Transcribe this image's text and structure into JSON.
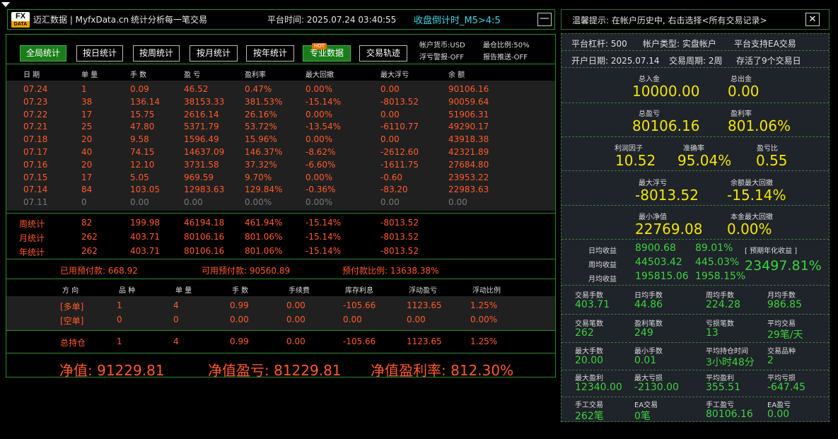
{
  "titlebar": {
    "logo_top": "FX",
    "logo_bottom": "DATA",
    "brand": "迈汇数据 | MyfxData.cn",
    "slogan": "统计分析每一笔交易",
    "platform_time": "平台时间: 2025.07.24 03:40:55",
    "countdown": "收盘倒计时_M5>4:5",
    "minimize": "—"
  },
  "toolbar": {
    "buttons": [
      "全局统计",
      "按日统计",
      "按周统计",
      "按月统计",
      "按年统计",
      "专业数据",
      "交易轨迹"
    ],
    "hot_badge": "HOT",
    "currency": "帐户货币:USD",
    "float_alert": "浮亏警报-OFF",
    "max_position": "最仓比例:50%",
    "report_push": "报告推送-OFF"
  },
  "daily_table": {
    "headers": [
      "日 期",
      "单 量",
      "手 数",
      "盈 亏",
      "盈利率",
      "最大回撤",
      "最大浮亏",
      "余 额"
    ],
    "rows": [
      [
        "07.24",
        "1",
        "0.09",
        "46.52",
        "0.47%",
        "0.00%",
        "0.00",
        "90106.16"
      ],
      [
        "07.23",
        "38",
        "136.14",
        "38153.33",
        "381.53%",
        "-15.14%",
        "-8013.52",
        "90059.64"
      ],
      [
        "07.22",
        "17",
        "15.75",
        "2616.14",
        "26.16%",
        "0.00%",
        "0.00",
        "51906.31"
      ],
      [
        "07.21",
        "25",
        "47.80",
        "5371.79",
        "53.72%",
        "-13.54%",
        "-6110.77",
        "49290.17"
      ],
      [
        "07.18",
        "20",
        "9.58",
        "1596.49",
        "15.96%",
        "0.00%",
        "0.00",
        "43918.38"
      ],
      [
        "07.17",
        "40",
        "74.15",
        "14637.09",
        "146.37%",
        "-8.62%",
        "-2612.60",
        "42321.89"
      ],
      [
        "07.16",
        "20",
        "12.10",
        "3731.58",
        "37.32%",
        "-6.60%",
        "-1611.75",
        "27684.80"
      ],
      [
        "07.15",
        "17",
        "5.05",
        "969.59",
        "9.70%",
        "0.00%",
        "-0.60",
        "23953.22"
      ],
      [
        "07.14",
        "84",
        "103.05",
        "12983.63",
        "129.84%",
        "-0.36%",
        "-83.20",
        "22983.63"
      ],
      [
        "07.11",
        "0",
        "0.00",
        "0.00",
        "0.00%",
        "0.00%",
        "0.00",
        "0.00"
      ]
    ]
  },
  "summary_rows": [
    [
      "周统计",
      "82",
      "199.98",
      "46194.18",
      "461.94%",
      "-15.14%",
      "-8013.52"
    ],
    [
      "月统计",
      "262",
      "403.71",
      "80106.16",
      "801.06%",
      "-15.14%",
      "-8013.52"
    ],
    [
      "年统计",
      "262",
      "403.71",
      "80106.16",
      "801.06%",
      "-15.14%",
      "-8013.52"
    ]
  ],
  "margin": {
    "used": "已用预付款: 668.92",
    "free": "可用预付款: 90560.89",
    "ratio": "预付款比例: 13638.38%"
  },
  "positions": {
    "headers": [
      "方 向",
      "品 种",
      "单 量",
      "手 数",
      "手续费",
      "库存利息",
      "浮动盈亏",
      "浮动比例"
    ],
    "rows": [
      [
        "[多单]",
        "1",
        "4",
        "0.99",
        "0.00",
        "-105.66",
        "1123.65",
        "1.25%"
      ],
      [
        "[空单]",
        "0",
        "0",
        "0.00",
        "0.00",
        "0.00",
        "0.00",
        "0.00%"
      ]
    ],
    "total": [
      "总持仓",
      "1",
      "4",
      "0.99",
      "0.00",
      "-105.66",
      "1123.65",
      "1.25%"
    ]
  },
  "footer": {
    "equity": "净值: 91229.81",
    "equity_pl": "净值盈亏: 81229.81",
    "equity_rate": "净值盈利率: 812.30%"
  },
  "right": {
    "tip": "温馨提示: 在帐户历史中, 右击选择<所有交易记录>",
    "close": "✕",
    "leverage": "平台杠杆: 500",
    "account_type": "帐户类型: 实盘帐户",
    "ea_support": "平台支持EA交易",
    "open_date": "开户日期: 2025.07.14",
    "period": "交易周期: 2周",
    "alive": "存活了9个交易日",
    "deposit_label": "总入金",
    "deposit": "10000.00",
    "withdraw_label": "总出金",
    "withdraw": "0.00",
    "profit_label": "总盈亏",
    "profit": "80106.16",
    "profit_rate_label": "盈利率",
    "profit_rate": "801.06%",
    "pf_label": "利润因子",
    "pf": "10.52",
    "accuracy_label": "准确率",
    "accuracy": "95.04%",
    "pl_ratio_label": "盈亏比",
    "pl_ratio": "0.55",
    "max_float_label": "最大浮亏",
    "max_float": "-8013.52",
    "max_dd_label": "余额最大回撤",
    "max_dd": "-15.14%",
    "min_equity_label": "最小净值",
    "min_equity": "22769.08",
    "capital_dd_label": "本金最大回撤",
    "capital_dd": "0.00%",
    "daily_label": "日均收益",
    "daily": "8900.68",
    "daily_pct": "89.01%",
    "weekly_label": "周均收益",
    "weekly": "44503.42",
    "weekly_pct": "445.03%",
    "monthly_label": "月均收益",
    "monthly": "195815.06",
    "monthly_pct": "1958.15%",
    "annual_label": "[ 预期年化收益 ]",
    "annual": "23497.81%",
    "stats": [
      [
        [
          "交易手数",
          "403.71"
        ],
        [
          "日均手数",
          "44.86"
        ],
        [
          "周均手数",
          "224.28"
        ],
        [
          "月均手数",
          "986.85"
        ]
      ],
      [
        [
          "交易笔数",
          "262"
        ],
        [
          "盈利笔数",
          "249"
        ],
        [
          "亏损笔数",
          "13"
        ],
        [
          "平均交易",
          "29笔/天"
        ]
      ],
      [
        [
          "最大手数",
          "20.00"
        ],
        [
          "最小手数",
          "0.01"
        ],
        [
          "平均持仓时间",
          "3小时48分"
        ],
        [
          "交易品种",
          "2"
        ]
      ],
      [
        [
          "最大盈利",
          "12340.00"
        ],
        [
          "最大亏损",
          "-2130.00"
        ],
        [
          "平均盈利",
          "355.51"
        ],
        [
          "平均亏损",
          "-647.45"
        ]
      ],
      [
        [
          "手工交易",
          "262笔"
        ],
        [
          "EA交易",
          "0笔"
        ],
        [
          "手工盈亏",
          "80106.16"
        ],
        [
          "EA盈亏",
          "0.00"
        ]
      ]
    ]
  }
}
